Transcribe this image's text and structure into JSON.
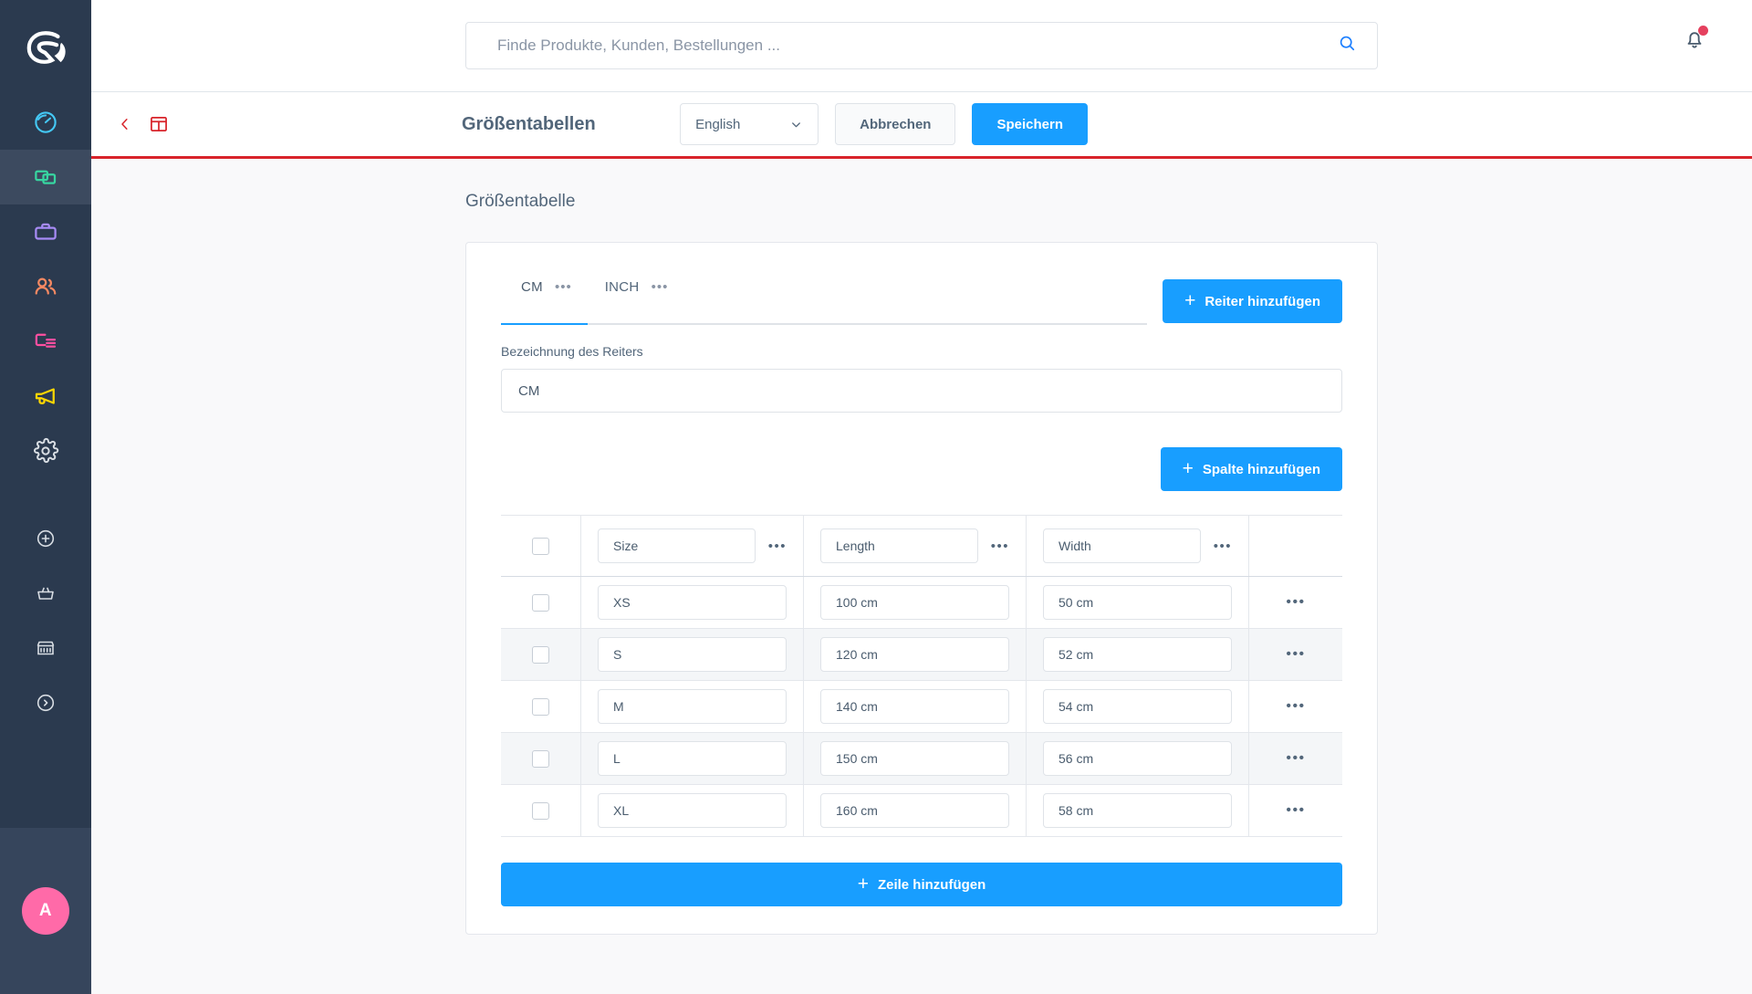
{
  "sidebar": {
    "logo_name": "shopware-logo",
    "items": [
      {
        "name": "dashboard",
        "icon": "gauge-icon",
        "color": "#44c8f5",
        "active": false
      },
      {
        "name": "catalogues",
        "icon": "copy-stack-icon",
        "color": "#37d5a0",
        "active": true
      },
      {
        "name": "orders",
        "icon": "briefcase-icon",
        "color": "#a78bf5",
        "active": false
      },
      {
        "name": "customers",
        "icon": "users-icon",
        "color": "#f88962",
        "active": false
      },
      {
        "name": "content",
        "icon": "content-list-icon",
        "color": "#ff4fa0",
        "active": false
      },
      {
        "name": "marketing",
        "icon": "megaphone-icon",
        "color": "#ffd700",
        "active": false
      },
      {
        "name": "settings",
        "icon": "gear-icon",
        "color": "#d8dde3",
        "active": false
      }
    ],
    "extra_items": [
      {
        "name": "add",
        "icon": "plus-circle-icon",
        "color": "#d8dde3"
      },
      {
        "name": "extensions",
        "icon": "basket-icon",
        "color": "#d8dde3"
      },
      {
        "name": "sales-channel",
        "icon": "storefront-icon",
        "color": "#d8dde3"
      },
      {
        "name": "expand",
        "icon": "chevron-right-circle-icon",
        "color": "#d8dde3"
      }
    ],
    "avatar_initial": "A"
  },
  "topbar": {
    "search_placeholder": "Finde Produkte, Kunden, Bestellungen ...",
    "search_value": "",
    "search_icon": "search-icon",
    "bell_icon": "bell-icon",
    "bell_has_notification": true
  },
  "smartbar": {
    "back_icon": "chevron-left-icon",
    "panel_icon": "panel-layout-icon",
    "accent_color": "#d8232a",
    "title": "Größentabellen",
    "language": {
      "selected": "English",
      "chevron_icon": "chevron-down-icon",
      "options": [
        "English"
      ]
    },
    "cancel_label": "Abbrechen",
    "save_label": "Speichern",
    "primary_color": "#189eff"
  },
  "main": {
    "section_title": "Größentabelle",
    "tabs": [
      {
        "label": "CM",
        "active": true,
        "menu_icon": "ellipsis-icon"
      },
      {
        "label": "INCH",
        "active": false,
        "menu_icon": "ellipsis-icon"
      }
    ],
    "add_tab_label": "Reiter hinzufügen",
    "tab_name_label": "Bezeichnung des Reiters",
    "tab_name_value": "CM",
    "add_column_label": "Spalte hinzufügen",
    "add_row_label": "Zeile hinzufügen",
    "plus_glyph": "+",
    "table": {
      "select_all_checked": false,
      "columns": [
        {
          "label": "Size",
          "menu_icon": "ellipsis-icon"
        },
        {
          "label": "Length",
          "menu_icon": "ellipsis-icon"
        },
        {
          "label": "Width",
          "menu_icon": "ellipsis-icon"
        }
      ],
      "rows": [
        {
          "checked": false,
          "cells": [
            "XS",
            "100 cm",
            "50 cm"
          ],
          "menu_icon": "ellipsis-icon"
        },
        {
          "checked": false,
          "cells": [
            "S",
            "120 cm",
            "52 cm"
          ],
          "menu_icon": "ellipsis-icon"
        },
        {
          "checked": false,
          "cells": [
            "M",
            "140 cm",
            "54 cm"
          ],
          "menu_icon": "ellipsis-icon"
        },
        {
          "checked": false,
          "cells": [
            "L",
            "150 cm",
            "56 cm"
          ],
          "menu_icon": "ellipsis-icon"
        },
        {
          "checked": false,
          "cells": [
            "XL",
            "160 cm",
            "58 cm"
          ],
          "menu_icon": "ellipsis-icon"
        }
      ],
      "row_menu_glyph": "•••",
      "col_menu_glyph": "•••"
    }
  }
}
